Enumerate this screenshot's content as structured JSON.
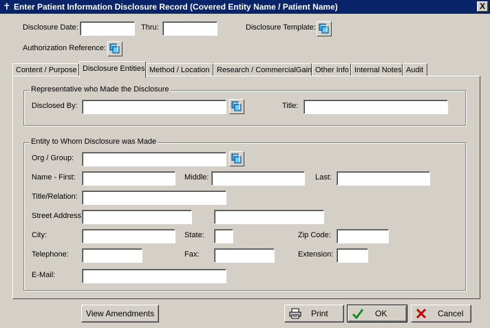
{
  "window": {
    "title": "Enter Patient Information Disclosure Record (Covered Entity Name / Patient Name)",
    "close_label": "X"
  },
  "header": {
    "disclosure_date_label": "Disclosure Date:",
    "disclosure_date_value": "",
    "thru_label": "Thru:",
    "thru_value": "",
    "template_label": "Disclosure Template:",
    "authorization_label": "Authorization Reference:"
  },
  "tabs": [
    {
      "label": "Content / Purpose",
      "active": false
    },
    {
      "label": "Disclosure Entities",
      "active": true
    },
    {
      "label": "Method / Location",
      "active": false
    },
    {
      "label": "Research / CommercialGain",
      "active": false
    },
    {
      "label": "Other Info",
      "active": false
    },
    {
      "label": "Internal Notes",
      "active": false
    },
    {
      "label": "Audit",
      "active": false
    }
  ],
  "representative": {
    "group_title": "Representative who Made the Disclosure",
    "disclosed_by_label": "Disclosed By:",
    "disclosed_by_value": "",
    "title_label": "Title:",
    "title_value": ""
  },
  "entity": {
    "group_title": "Entity to Whom Disclosure was Made",
    "org_label": "Org / Group:",
    "name_first_label": "Name - First:",
    "middle_label": "Middle:",
    "last_label": "Last:",
    "title_relation_label": "Title/Relation:",
    "street_label": "Street Address",
    "city_label": "City:",
    "state_label": "State:",
    "zip_label": "Zip Code:",
    "telephone_label": "Telephone:",
    "fax_label": "Fax:",
    "extension_label": "Extension:",
    "email_label": "E-Mail:"
  },
  "footer": {
    "view_amendments_label": "View Amendments",
    "print_label": "Print",
    "ok_label": "OK",
    "cancel_label": "Cancel"
  },
  "colors": {
    "titlebar": "#0a246a",
    "face": "#d4d0c8",
    "ok_check": "#1a8a1a",
    "cancel_x": "#c00000"
  },
  "icons": {
    "lookup": "lookup-icon",
    "print": "printer-icon",
    "ok": "checkmark-icon",
    "cancel": "x-icon"
  }
}
